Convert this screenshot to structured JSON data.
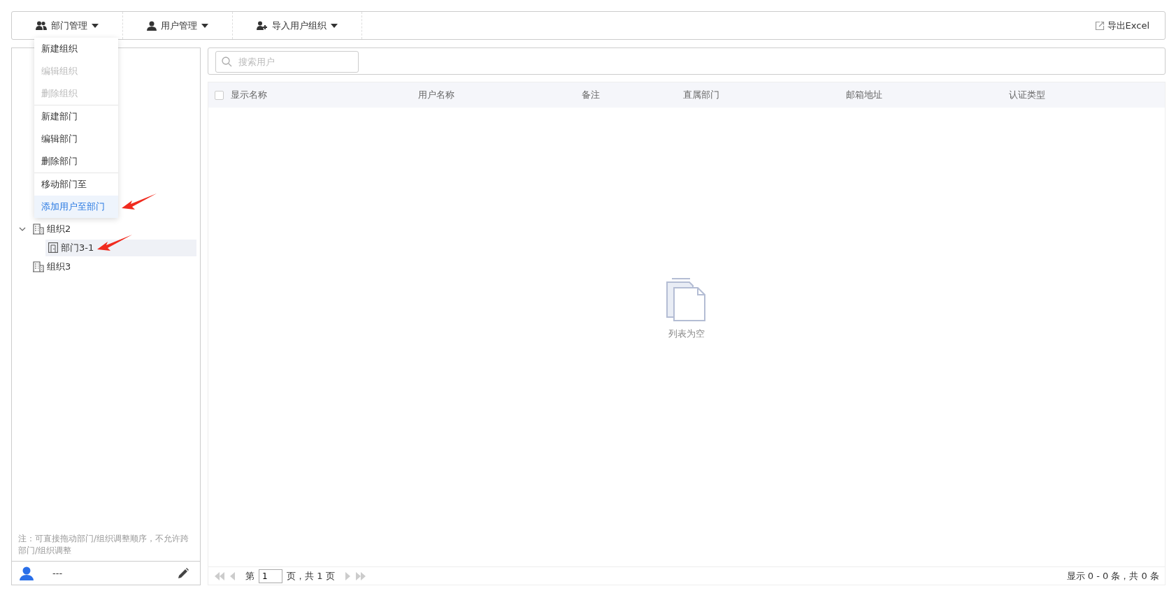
{
  "toolbar": {
    "menus": [
      {
        "label": "部门管理",
        "open": true
      },
      {
        "label": "用户管理",
        "open": false
      },
      {
        "label": "导入用户组织",
        "open": false
      }
    ],
    "export_button": {
      "label": "导出Excel"
    }
  },
  "dropdown_menu": {
    "groups": [
      [
        {
          "label": "新建组织",
          "disabled": false,
          "selected": false
        },
        {
          "label": "编辑组织",
          "disabled": true,
          "selected": false
        },
        {
          "label": "删除组织",
          "disabled": true,
          "selected": false
        }
      ],
      [
        {
          "label": "新建部门",
          "disabled": false,
          "selected": false
        },
        {
          "label": "编辑部门",
          "disabled": false,
          "selected": false
        },
        {
          "label": "删除部门",
          "disabled": false,
          "selected": false
        }
      ],
      [
        {
          "label": "移动部门至",
          "disabled": false,
          "selected": false
        },
        {
          "label": "添加用户至部门",
          "disabled": false,
          "selected": true,
          "pointed": true
        }
      ]
    ]
  },
  "tree": [
    {
      "label": "组织2",
      "kind": "org",
      "expanded": true,
      "selected": false,
      "children": [
        {
          "label": "部门3-1",
          "kind": "dept",
          "selected": true,
          "pointed": true
        }
      ]
    },
    {
      "label": "组织3",
      "kind": "org",
      "selected": false
    }
  ],
  "sidebar_note": "注：可直接拖动部门/组织调整顺序，不允许跨部门/组织调整",
  "sidebar_footer": {
    "user_name": "---"
  },
  "search": {
    "placeholder": "搜索用户"
  },
  "table": {
    "select_all": false,
    "columns": [
      "显示名称",
      "用户名称",
      "备注",
      "直属部门",
      "邮箱地址",
      "认证类型"
    ],
    "empty_text": "列表为空"
  },
  "pager": {
    "page_prefix": "第",
    "page": "1",
    "page_suffix": "页，共 1 页",
    "summary": "显示 0 - 0 条，共 0 条"
  }
}
